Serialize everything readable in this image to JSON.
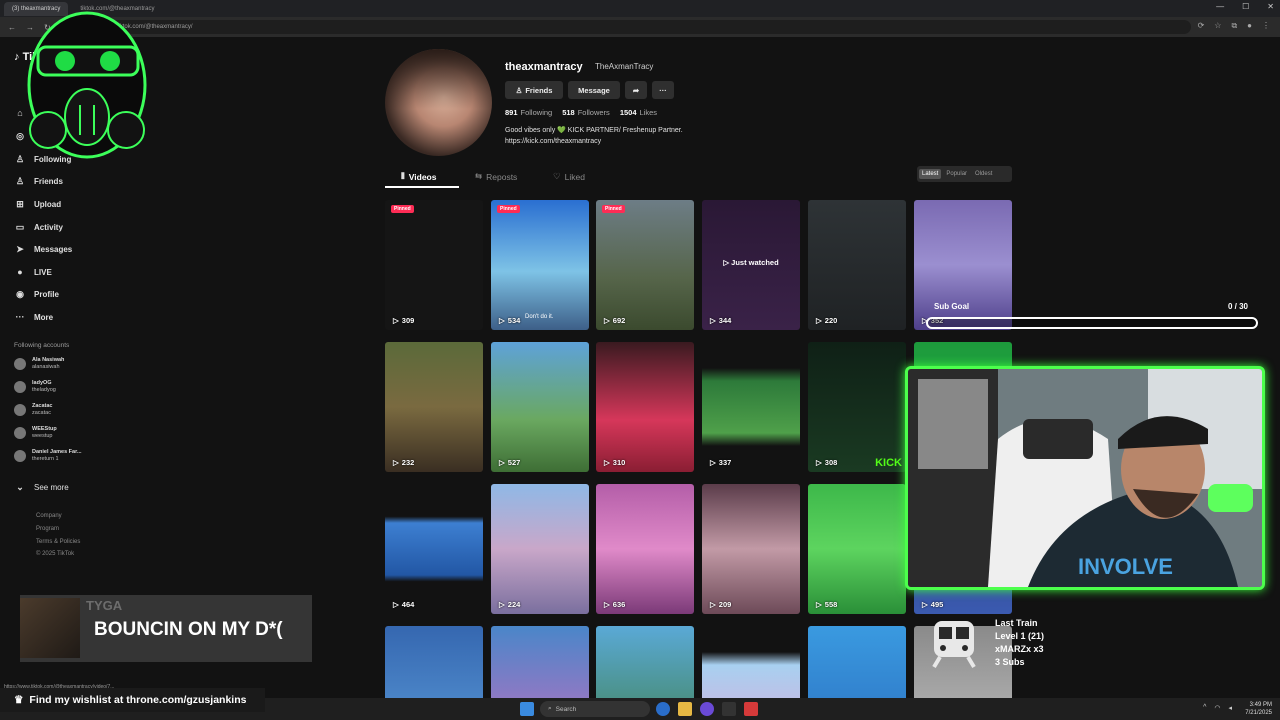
{
  "browser": {
    "tabs": [
      "(3) theaxmantracy",
      "tiktok.com/@theaxmantracy"
    ],
    "url": "tiktok.com/@theaxmantracy/",
    "controls": [
      "—",
      "☐",
      "✕"
    ]
  },
  "sidebar": {
    "logo": "TikTok",
    "items": [
      {
        "label": "For You",
        "icon": "home-icon",
        "glyph": "⌂"
      },
      {
        "label": "Explore",
        "icon": "compass-icon",
        "glyph": "◎"
      },
      {
        "label": "Following",
        "icon": "person-icon",
        "glyph": "♙"
      },
      {
        "label": "Friends",
        "icon": "friends-icon",
        "glyph": "♙"
      },
      {
        "label": "Upload",
        "icon": "upload-icon",
        "glyph": "⊞"
      },
      {
        "label": "Activity",
        "icon": "activity-icon",
        "glyph": "▭"
      },
      {
        "label": "Messages",
        "icon": "messages-icon",
        "glyph": "➤"
      },
      {
        "label": "LIVE",
        "icon": "live-icon",
        "glyph": "●"
      },
      {
        "label": "Profile",
        "icon": "profile-icon",
        "glyph": "◉"
      },
      {
        "label": "More",
        "icon": "more-icon",
        "glyph": "···"
      }
    ],
    "following_title": "Following accounts",
    "accounts": [
      {
        "name": "Ala Nasiwah",
        "handle": "alanasiwah"
      },
      {
        "name": "ladyOG",
        "handle": "theladyog"
      },
      {
        "name": "Zacatac",
        "handle": "zacatac"
      },
      {
        "name": "WEEStup",
        "handle": "weestup"
      },
      {
        "name": "Daniel James Far...",
        "handle": "thereturn 1"
      }
    ],
    "see_more": "See more",
    "footer": [
      "Company",
      "Program",
      "Terms & Policies",
      "© 2025 TikTok"
    ]
  },
  "profile": {
    "username": "theaxmantracy",
    "nickname": "TheAxmanTracy",
    "buttons": {
      "friends": "Friends",
      "message": "Message"
    },
    "stats": [
      {
        "value": "891",
        "label": "Following"
      },
      {
        "value": "518",
        "label": "Followers"
      },
      {
        "value": "1504",
        "label": "Likes"
      }
    ],
    "bio_line1": "Good vibes only 💚 KICK PARTNER/ Freshenup Partner.",
    "bio_line2": "https://kick.com/theaxmantracy",
    "tabs": {
      "videos": "Videos",
      "reposts": "Reposts",
      "liked": "Liked"
    },
    "sort": [
      "Latest",
      "Popular",
      "Oldest"
    ]
  },
  "videos": [
    {
      "plays": "309",
      "pinned": "Pinned",
      "bg": "#151515"
    },
    {
      "plays": "534",
      "pinned": "Pinned",
      "bg": "linear-gradient(180deg,#2a6fd1,#7ec3e6 55%,#3d5f88)",
      "caption": "Don't do it."
    },
    {
      "plays": "692",
      "pinned": "Pinned",
      "bg": "linear-gradient(180deg,#6d7d86,#56654a 60%,#3b4a2e)"
    },
    {
      "plays": "344",
      "bg": "linear-gradient(180deg,#2a1835,#3a2248)",
      "overlay": "Just watched"
    },
    {
      "plays": "220",
      "bg": "linear-gradient(180deg,#2e3336,#1f2224)"
    },
    {
      "plays": "352",
      "bg": "linear-gradient(180deg,#7a6ab2,#9b8fd0 50%,#4e3f8a)"
    },
    {
      "plays": "232",
      "bg": "linear-gradient(180deg,#5b6a3a,#7a6a40 50%,#3a2e22)"
    },
    {
      "plays": "527",
      "bg": "linear-gradient(180deg,#5ea2d9,#6aa860 60%,#3e6e35)"
    },
    {
      "plays": "310",
      "bg": "linear-gradient(180deg,#3a1a20,#d6375a 60%,#8a1e33)"
    },
    {
      "plays": "337",
      "bg": "linear-gradient(180deg,#121212 20%,#2d7a3a 30%,#4fa04a 70%,#121212 80%)"
    },
    {
      "plays": "308",
      "bg": "linear-gradient(180deg,#0f2016,#1a3a22)",
      "kick": "KICK"
    },
    {
      "plays": "",
      "bg": "linear-gradient(180deg,#1d9a3c,#28b54a)"
    },
    {
      "plays": "464",
      "bg": "linear-gradient(180deg,#121212 25%,#3d7fd1 30%,#2257a5 70%,#121212 75%)"
    },
    {
      "plays": "224",
      "bg": "linear-gradient(180deg,#8fb8e6,#c9a7c9 50%,#7a6f9e)"
    },
    {
      "plays": "636",
      "bg": "linear-gradient(180deg,#b45ea8,#e08ac9 50%,#7b3a78)"
    },
    {
      "plays": "209",
      "bg": "linear-gradient(180deg,#5b3c4a,#c29aa6 50%,#6d4a58)"
    },
    {
      "plays": "558",
      "bg": "linear-gradient(180deg,#3db84a,#5dd45f 50%,#2a8f38)"
    },
    {
      "plays": "495",
      "bg": "linear-gradient(180deg,#2b3f7a,#3b5ab0)"
    },
    {
      "plays": "",
      "bg": "linear-gradient(180deg,#3567b0,#5a9ad8)"
    },
    {
      "plays": "",
      "bg": "linear-gradient(180deg,#4a86c9,#c36fc0)"
    },
    {
      "plays": "",
      "bg": "linear-gradient(180deg,#5aa9d6,#3f7f4a)"
    },
    {
      "plays": "",
      "bg": "linear-gradient(180deg,#121212 20%,#a8d0f0 30%,#e0a8d8 100%)"
    },
    {
      "plays": "",
      "bg": "linear-gradient(180deg,#3a9ae0,#2b6fc0)"
    },
    {
      "plays": "",
      "bg": "linear-gradient(180deg,#8a8a8a,#c0c0c0)"
    }
  ],
  "overlay": {
    "sub_goal_title": "Sub Goal",
    "sub_goal_count": "0 / 30",
    "sub_goal_progress": 0,
    "music_artist": "TYGA",
    "music_title": "BOUNCIN ON MY D*(",
    "train_title": "Last Train",
    "train_level": "Level 1  (21)",
    "train_user": "xMARZx x3",
    "train_subs": "3 Subs",
    "wishlist": "Find my wishlist at throne.com/gzusjankins",
    "status_url": "https://www.tiktok.com/@theaxmantracy/video/7..."
  },
  "taskbar": {
    "search": "Search",
    "time": "3:49 PM",
    "date": "7/21/2025"
  },
  "colors": {
    "accent_green": "#4cff4c",
    "tiktok_red": "#fe2c55"
  }
}
